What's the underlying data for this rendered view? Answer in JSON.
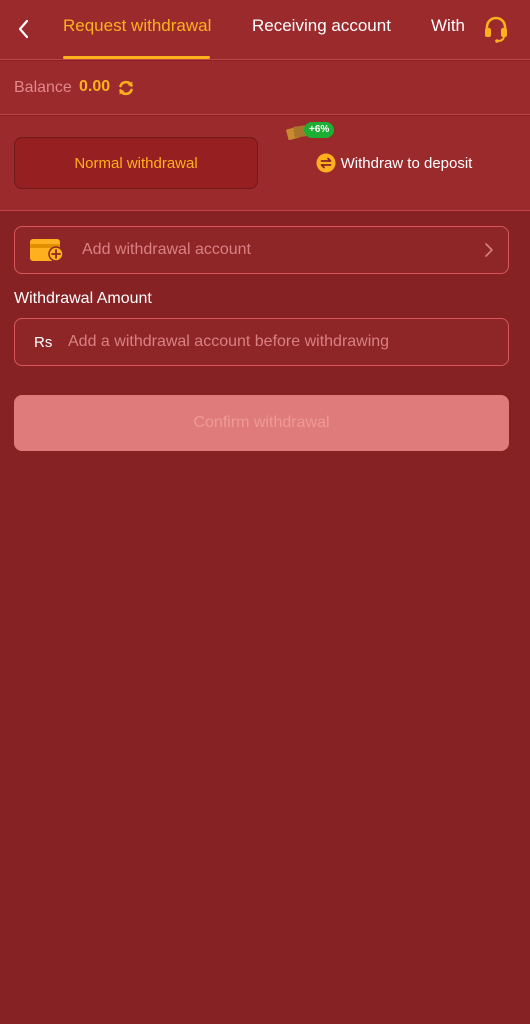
{
  "header": {
    "tabs": [
      {
        "label": "Request withdrawal",
        "active": true
      },
      {
        "label": "Receiving account",
        "active": false
      },
      {
        "label": "With",
        "active": false
      }
    ],
    "accent_color": "#FFB01E"
  },
  "balance": {
    "label": "Balance",
    "value": "0.00"
  },
  "methods": {
    "normal_label": "Normal withdrawal",
    "deposit_label": "Withdraw to deposit",
    "deposit_badge": "+6%"
  },
  "account": {
    "add_label": "Add withdrawal account"
  },
  "amount": {
    "label": "Withdrawal Amount",
    "currency": "Rs",
    "placeholder": "Add a withdrawal account before withdrawing"
  },
  "confirm": {
    "label": "Confirm withdrawal"
  },
  "icons": {
    "back": "chevron-left-icon",
    "support": "headset-icon",
    "refresh": "refresh-icon",
    "deposit": "swap-icon",
    "wallet": "wallet-add-icon",
    "chevron": "chevron-right-icon"
  }
}
